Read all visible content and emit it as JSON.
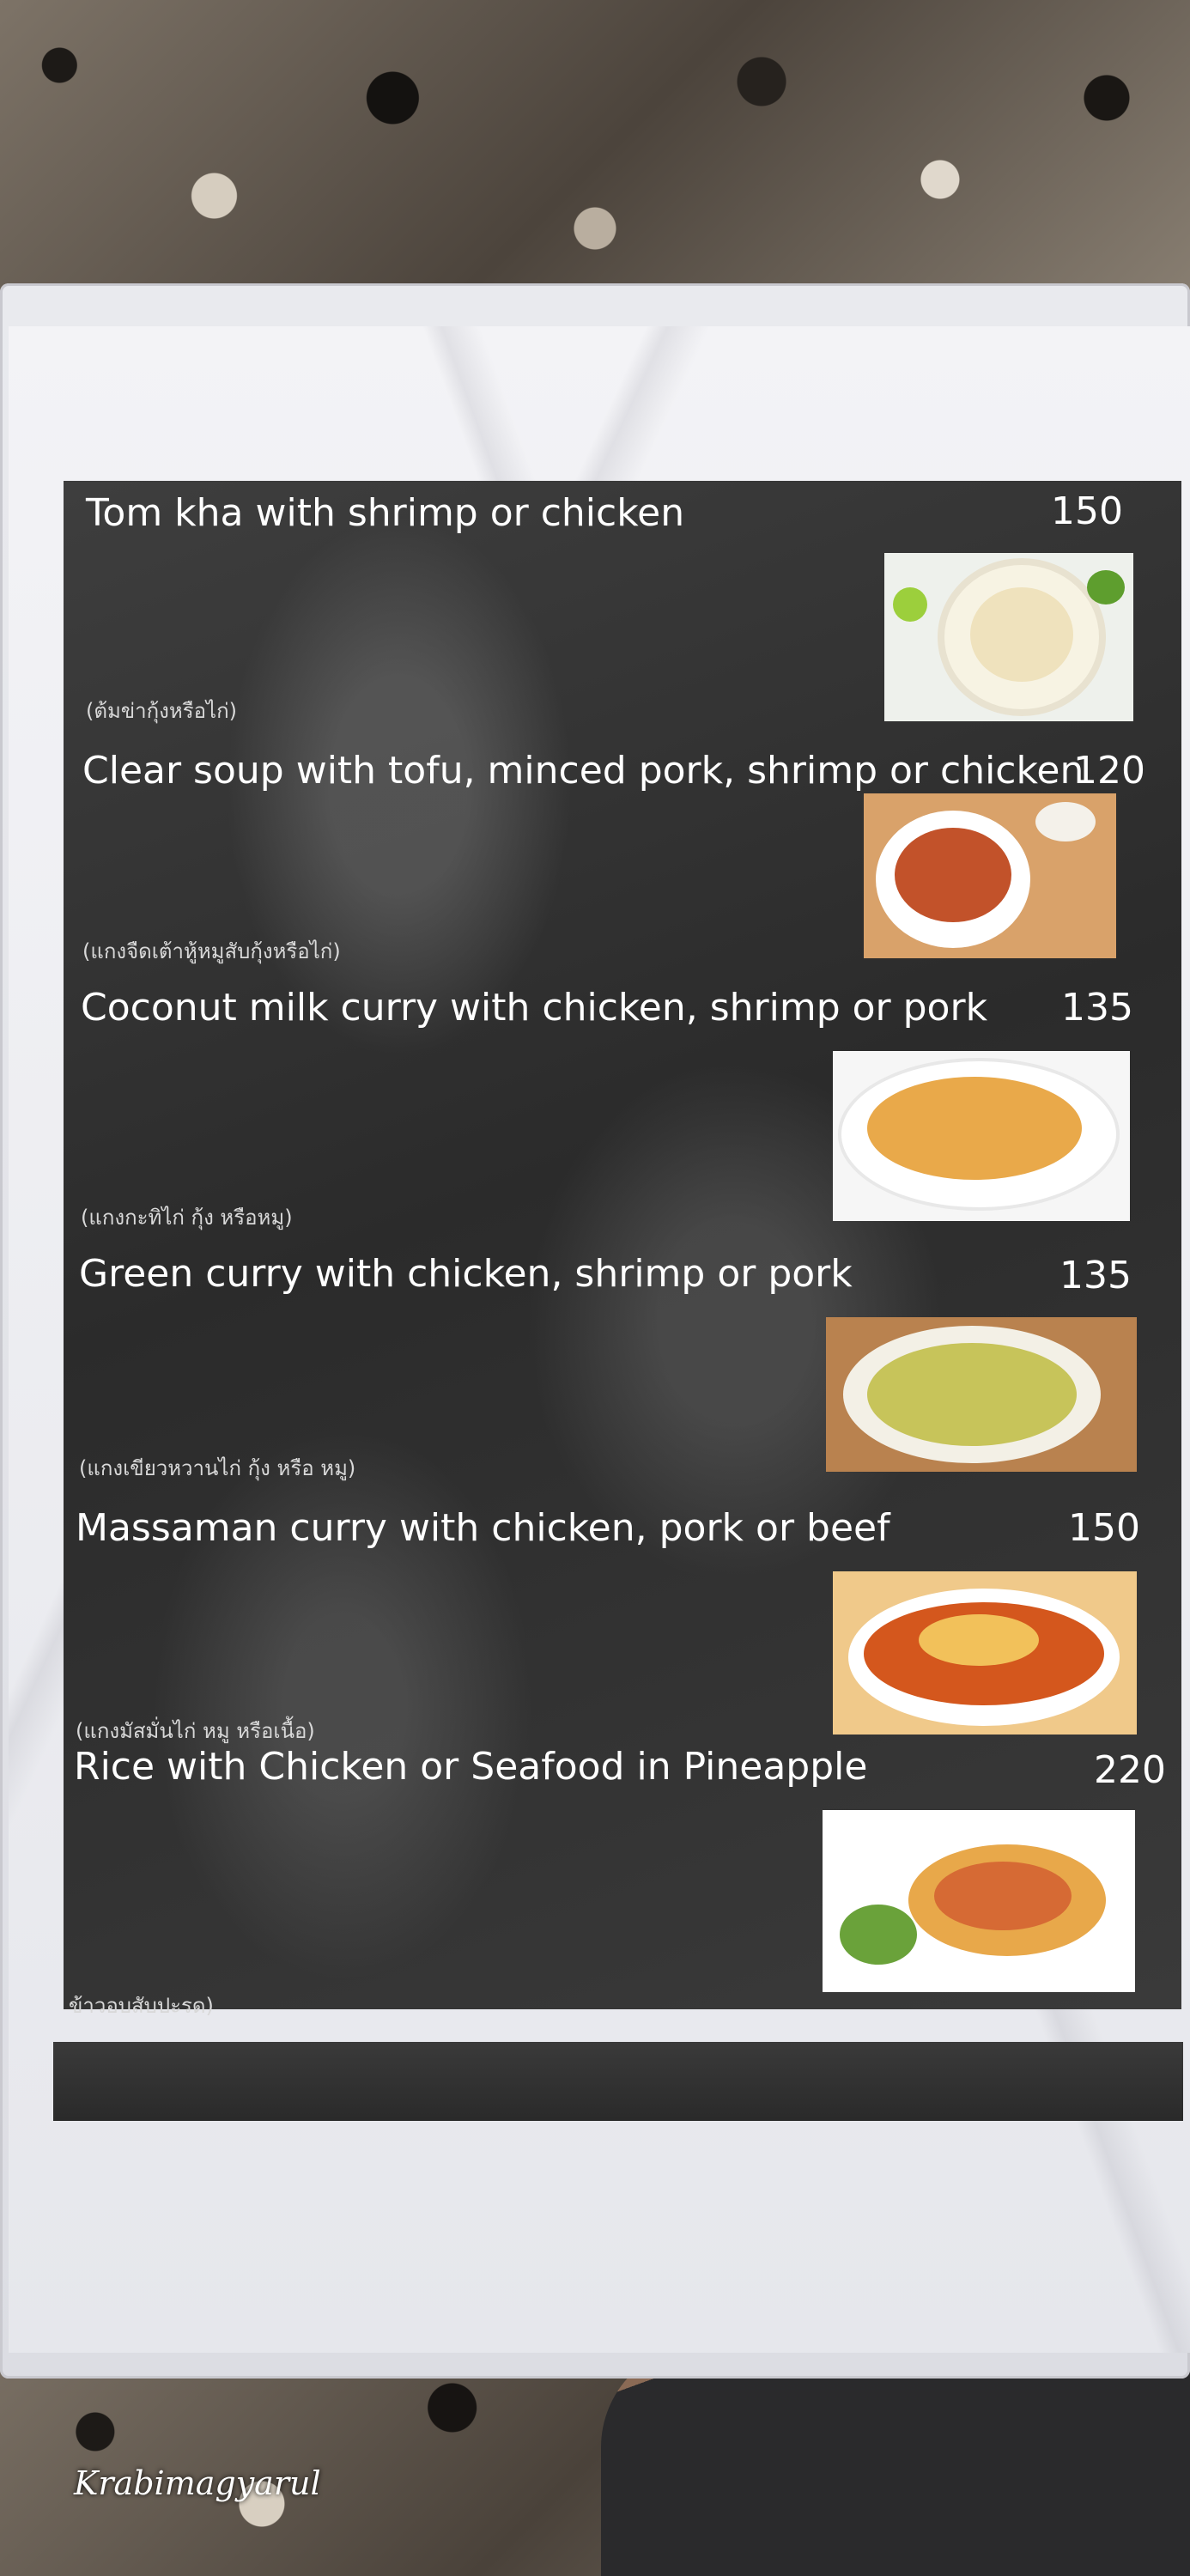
{
  "menu": {
    "items": [
      {
        "title": "Tom kha with shrimp or chicken",
        "price": "150",
        "thai": "(ต้มข่ากุ้งหรือไก่)",
        "photo_icon": "soup-bowl-photo"
      },
      {
        "title": "Clear soup with tofu, minced pork, shrimp or chicken",
        "price": "120",
        "thai": "(แกงจืดเต้าหู้หมูสับกุ้งหรือไก่)",
        "photo_icon": "clear-soup-photo"
      },
      {
        "title": "Coconut milk curry with chicken, shrimp or pork",
        "price": "135",
        "thai": "(แกงกะทิไก่ กุ้ง หรือหมู)",
        "photo_icon": "coconut-curry-photo"
      },
      {
        "title": "Green curry with chicken, shrimp or pork",
        "price": "135",
        "thai": "(แกงเขียวหวานไก่ กุ้ง หรือ หมู)",
        "photo_icon": "green-curry-photo"
      },
      {
        "title": "Massaman curry with chicken, pork or beef",
        "price": "150",
        "thai": "(แกงมัสมั่นไก่ หมู หรือเนื้อ)",
        "photo_icon": "massaman-curry-photo"
      },
      {
        "title": "Rice with Chicken or Seafood in Pineapple",
        "price": "220",
        "thai": "ข้าวอบสับปะรด)",
        "photo_icon": "pineapple-rice-photo"
      }
    ]
  },
  "watermark": "Krabimagyarul",
  "colors": {
    "panel": "#2f2f2f",
    "text": "#ffffff",
    "thai_text": "#d8d8d8",
    "paper": "#eceef2"
  }
}
